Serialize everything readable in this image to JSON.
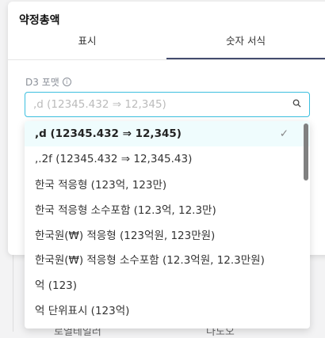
{
  "background": {
    "texts": [
      "로열테일러",
      "나도오"
    ]
  },
  "panel": {
    "title": "약정총액",
    "tabs": [
      {
        "label": "표시"
      },
      {
        "label": "숫자 서식",
        "active": true
      }
    ],
    "field_label": "D3 포맷",
    "info_icon": "i",
    "input": {
      "value": "",
      "placeholder": ",d (12345.432 ⇒ 12,345)"
    },
    "search_icon": "⚲"
  },
  "dropdown": {
    "check": "✓",
    "items": [
      ",d (12345.432 ⇒ 12,345)",
      ",.2f (12345.432 ⇒ 12,345.43)",
      "한국 적응형 (123억, 123만)",
      "한국 적응형 소수포함 (12.3억, 12.3만)",
      "한국원(₩) 적응형 (123억원, 123만원)",
      "한국원(₩) 적응형 소수포함 (12.3억원, 12.3만원)",
      "억 (123)",
      "억 단위표시 (123억)"
    ]
  }
}
